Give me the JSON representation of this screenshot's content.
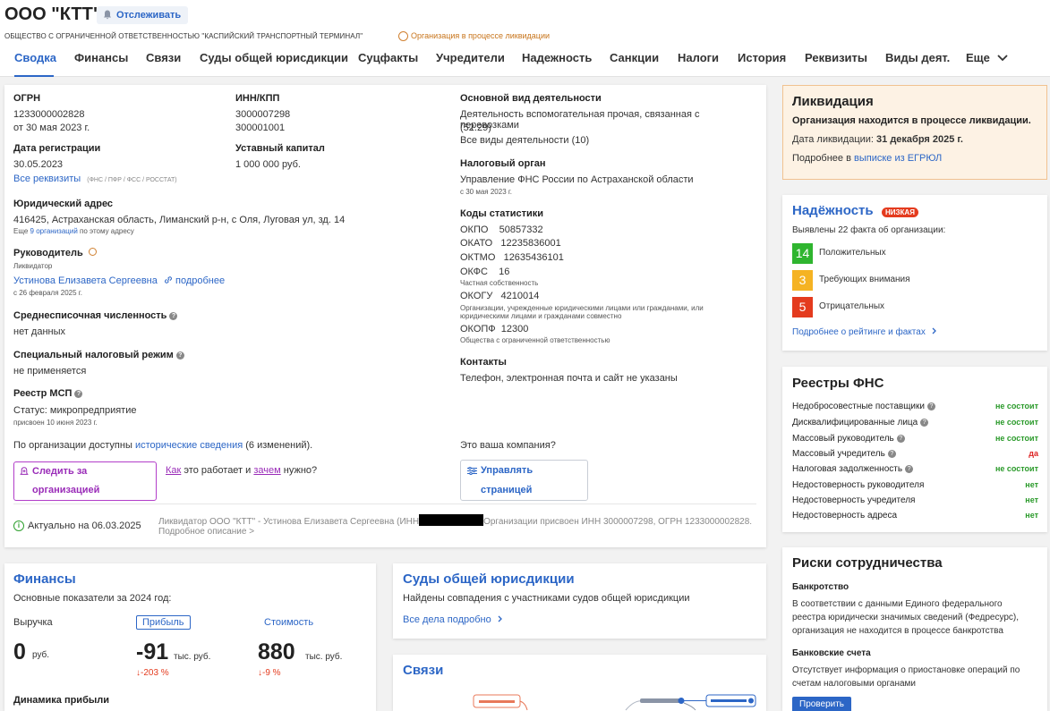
{
  "header": {
    "title": "ООО \"КТТ\"",
    "track_label": "Отслеживать",
    "full_name": "ОБЩЕСТВО С ОГРАНИЧЕННОЙ ОТВЕТСТВЕННОСТЬЮ \"КАСПИЙСКИЙ ТРАНСПОРТНЫЙ ТЕРМИНАЛ\"",
    "status": "Организация в процессе ликвидации",
    "status_color": "#c8751c"
  },
  "tabs": [
    {
      "label": "Сводка"
    },
    {
      "label": "Финансы"
    },
    {
      "label": "Связи"
    },
    {
      "label": "Суды общей юрисдикции"
    },
    {
      "label": "Суцфакты"
    },
    {
      "label": "Учредители"
    },
    {
      "label": "Надежность"
    },
    {
      "label": "Санкции"
    },
    {
      "label": "Налоги"
    },
    {
      "label": "История"
    },
    {
      "label": "Реквизиты"
    },
    {
      "label": "Виды деят."
    },
    {
      "label": "Еще"
    }
  ],
  "summary": {
    "ogrn_label": "ОГРН",
    "ogrn": "1233000002828",
    "ogrn_date": "от 30 мая 2023 г.",
    "inn_label": "ИНН/КПП",
    "inn": "3000007298",
    "kpp": "300001001",
    "reg_label": "Дата регистрации",
    "reg_date": "30.05.2023",
    "capital_label": "Уставный капитал",
    "capital": "1 000 000 руб.",
    "all_req": "Все реквизиты",
    "req_sources": "(ФНС / ПФР / ФСС / РОССТАТ)",
    "addr_label": "Юридический адрес",
    "addr": "416425, Астраханская область, Лиманский р-н, с Оля, Луговая ул, зд. 14",
    "addr_more_pre": "Еще",
    "addr_more_link": "9 организаций",
    "addr_more_post": "по этому адресу",
    "head_label": "Руководитель",
    "head_role": "Ликвидатор",
    "head_name": "Устинова Елизавета Сергеевна",
    "head_more": "подробнее",
    "head_since": "с 26 февраля 2025 г.",
    "staff_label": "Среднесписочная численность",
    "staff": "нет данных",
    "tax_label": "Специальный налоговый режим",
    "tax": "не применяется",
    "msp_label": "Реестр МСП",
    "msp_status": "Статус: микропредприятие",
    "msp_date": "присвоен 10 июня 2023 г.",
    "hist_pre": "По организации доступны",
    "hist_link": "исторические сведения",
    "hist_post": "(6 изменений).",
    "follow_btn": "Следить за организацией",
    "how_pre": "Как",
    "how_mid": "это работает и",
    "how_link": "зачем",
    "how_post": "нужно?",
    "activity_label": "Основной вид деятельности",
    "activity": "Деятельность вспомогательная прочая, связанная с перевозками",
    "activity_code": "(52.29)",
    "activity_all": "Все виды деятельности (10)",
    "taxorg_label": "Налоговый орган",
    "taxorg": "Управление ФНС России по Астраханской области",
    "taxorg_date": "с 30 мая 2023 г.",
    "stat_label": "Коды статистики",
    "okpo": "ОКПО    50857332",
    "okato": "ОКАТО   12235836001",
    "oktmo": "ОКТМО   12635436101",
    "okfs": "ОКФС    16",
    "okfs_desc": "Частная собственность",
    "okogu": "ОКОГУ   4210014",
    "okogu_desc": "Организации, учрежденные юридическими лицами или гражданами, или юридическими лицами и гражданами совместно",
    "okopf": "ОКОПФ  12300",
    "okopf_desc": "Общества с ограниченной ответственностью",
    "contacts_label": "Контакты",
    "contacts": "Телефон, электронная почта и сайт не указаны",
    "own_q": "Это ваша компания?",
    "manage_btn": "Управлять страницей",
    "actual": "Актуально на 06.03.2025",
    "footer_a": "Ликвидатор ООО \"КТТ\" - Устинова Елизавета Сергеевна (ИНН",
    "footer_b": "Организации присвоен ИНН 3000007298, ОГРН 1233000002828.",
    "footer_more": "Подробное описание >"
  },
  "liquidation": {
    "title": "Ликвидация",
    "text": "Организация находится в процессе ликвидации.",
    "date_label": "Дата ликвидации:",
    "date": "31 декабря 2025 г.",
    "more_pre": "Подробнее в",
    "more_link": "выписке из ЕГРЮЛ"
  },
  "reliability": {
    "title": "Надёжность",
    "badge": "НИЗКАЯ",
    "found": "Выявлены 22 факта об организации:",
    "items": [
      {
        "count": "14",
        "label": "Положительных",
        "color": "#2fb52f"
      },
      {
        "count": "3",
        "label": "Требующих внимания",
        "color": "#f5b323"
      },
      {
        "count": "5",
        "label": "Отрицательных",
        "color": "#e43b1e"
      }
    ],
    "more": "Подробнее о рейтинге и фактах"
  },
  "registries": {
    "title": "Реестры ФНС",
    "rows": [
      {
        "label": "Недобросовестные поставщики",
        "status": "не состоит"
      },
      {
        "label": "Дисквалифицированные лица",
        "status": "не состоит"
      },
      {
        "label": "Массовый руководитель",
        "status": "не состоит"
      },
      {
        "label": "Массовый учредитель",
        "status": "да"
      },
      {
        "label": "Налоговая задолженность",
        "status": "не состоит"
      },
      {
        "label": "Недостоверность руководителя",
        "status": "нет"
      },
      {
        "label": "Недостоверность учредителя",
        "status": "нет"
      },
      {
        "label": "Недостоверность адреса",
        "status": "нет"
      }
    ]
  },
  "risks": {
    "title": "Риски сотрудничества",
    "bank_label": "Банкротство",
    "bank_text_1": "В соответствии с данными Единого федерального",
    "bank_text_2": "реестра юридически значимых сведений (Федресурс),",
    "bank_text_3": "организация не находится в процессе банкротства",
    "acc_label": "Банковские счета",
    "acc_text_1": "Отсутствует информация о приостановке операций по",
    "acc_text_2": "счетам налоговыми органами",
    "check_btn": "Проверить"
  },
  "finance": {
    "title": "Финансы",
    "subtitle": "Основные показатели за 2024 год:",
    "revenue_label": "Выручка",
    "profit_label": "Прибыль",
    "value_label": "Стоимость",
    "revenue": "0",
    "revenue_unit": "руб.",
    "profit": "-91",
    "profit_unit": "тыс. руб.",
    "profit_change": "↓-203 %",
    "value": "880",
    "value_unit": "тыс. руб.",
    "value_change": "↓-9 %",
    "dynamics": "Динамика прибыли"
  },
  "courts": {
    "title": "Суды общей юрисдикции",
    "text": "Найдены совпадения с участниками судов общей юрисдикции",
    "link": "Все дела подробно"
  },
  "links": {
    "title": "Связи"
  }
}
